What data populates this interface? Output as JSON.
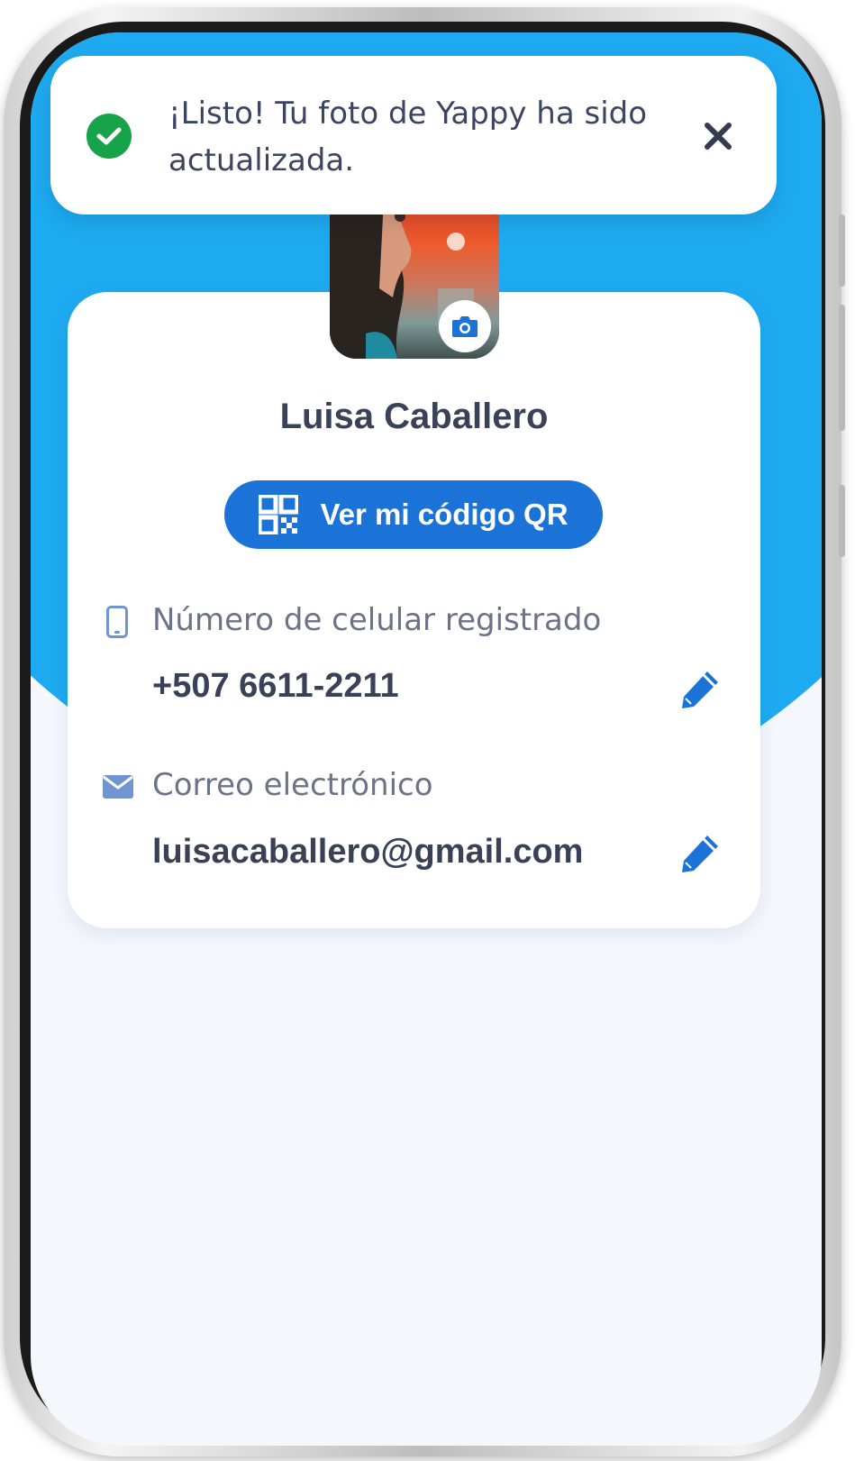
{
  "toast": {
    "message": "¡Listo! Tu foto de Yappy ha sido actualizada.",
    "status_color": "#17a34a",
    "icon": "check-circle-icon",
    "close_icon": "close-icon"
  },
  "profile": {
    "name": "Luisa Caballero",
    "avatar_icon": "camera-icon",
    "qr_button_label": "Ver mi código QR",
    "qr_icon": "qr-code-icon"
  },
  "fields": {
    "phone": {
      "label": "Número de celular registrado",
      "value": "+507 6611-2211",
      "icon": "mobile-phone-icon",
      "edit_icon": "pencil-icon"
    },
    "email": {
      "label": "Correo electrónico",
      "value": "luisacaballero@gmail.com",
      "icon": "envelope-icon",
      "edit_icon": "pencil-icon"
    }
  },
  "colors": {
    "header_blue": "#1eaaf1",
    "button_blue": "#1b73d8",
    "page_bg": "#f4f7fc",
    "text_dark": "#394157",
    "text_muted": "#6b7386"
  }
}
